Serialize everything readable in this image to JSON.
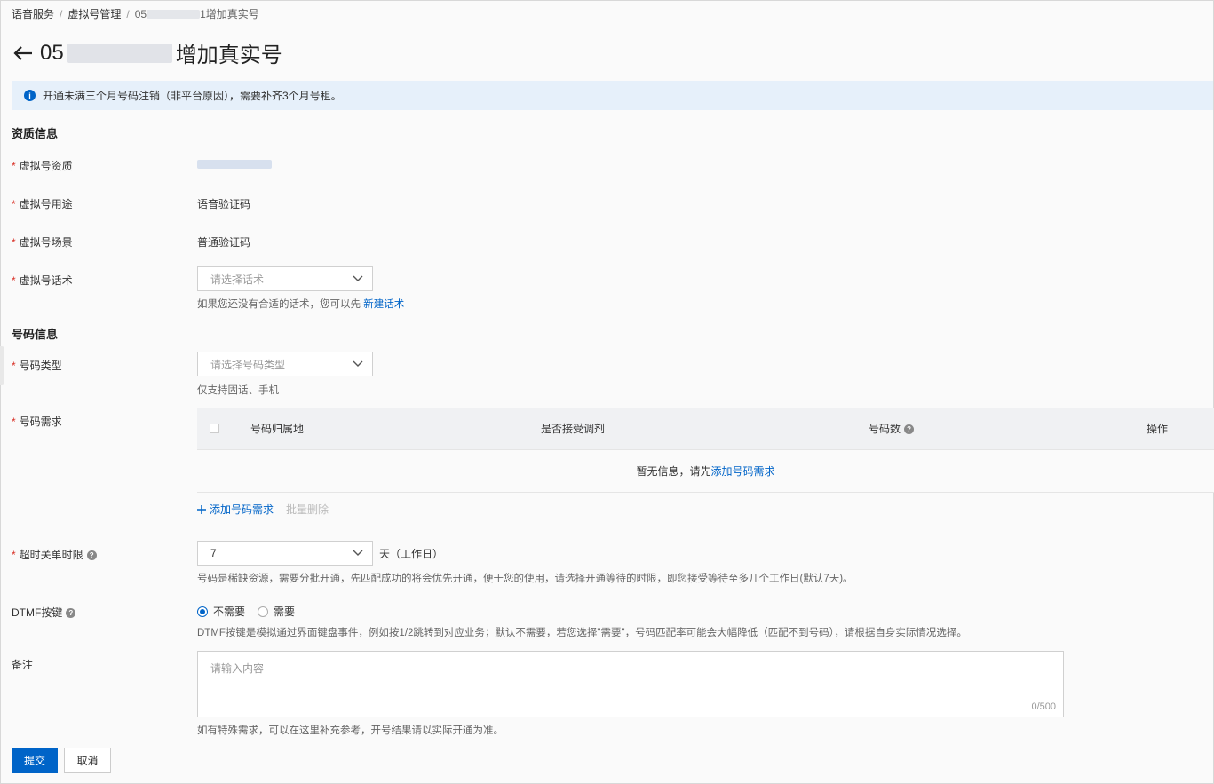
{
  "breadcrumb": {
    "item1": "语音服务",
    "item2": "虚拟号管理",
    "item3_prefix": "05",
    "item3_suffix": "1增加真实号",
    "sep": "/"
  },
  "header": {
    "title_prefix": "05",
    "title_suffix": "增加真实号"
  },
  "alert": {
    "text": "开通未满三个月号码注销（非平台原因），需要补齐3个月号租。"
  },
  "qualification": {
    "section_title": "资质信息",
    "qual_label": "虚拟号资质",
    "usage_label": "虚拟号用途",
    "usage_value": "语音验证码",
    "scene_label": "虚拟号场景",
    "scene_value": "普通验证码",
    "script_label": "虚拟号话术",
    "script_placeholder": "请选择话术",
    "script_help": "如果您还没有合适的话术，您可以先",
    "script_help_link": "新建话术"
  },
  "number_info": {
    "section_title": "号码信息",
    "type_label": "号码类型",
    "type_placeholder": "请选择号码类型",
    "type_help": "仅支持固话、手机",
    "demand_label": "号码需求",
    "table_headers": {
      "location": "号码归属地",
      "accept": "是否接受调剂",
      "count": "号码数",
      "ops": "操作"
    },
    "empty_text": "暂无信息，请先",
    "empty_link": "添加号码需求",
    "add_label": "添加号码需求",
    "batch_delete_label": "批量删除"
  },
  "timeout": {
    "label": "超时关单时限",
    "value": "7",
    "unit": "天（工作日）",
    "help": "号码是稀缺资源，需要分批开通，先匹配成功的将会优先开通，便于您的使用，请选择开通等待的时限，即您接受等待至多几个工作日(默认7天)。"
  },
  "dtmf": {
    "label": "DTMF按键",
    "option_no": "不需要",
    "option_yes": "需要",
    "selected": "不需要",
    "help": "DTMF按键是模拟通过界面键盘事件，例如按1/2跳转到对应业务；默认不需要，若您选择\"需要\"，号码匹配率可能会大幅降低（匹配不到号码），请根据自身实际情况选择。"
  },
  "remark": {
    "label": "备注",
    "placeholder": "请输入内容",
    "counter": "0/500",
    "help": "如有特殊需求，可以在这里补充参考，开号结果请以实际开通为准。"
  },
  "buttons": {
    "submit": "提交",
    "cancel": "取消"
  },
  "colors": {
    "primary": "#0064c8",
    "alert_bg": "#e6f0fa",
    "required": "#d93026"
  }
}
